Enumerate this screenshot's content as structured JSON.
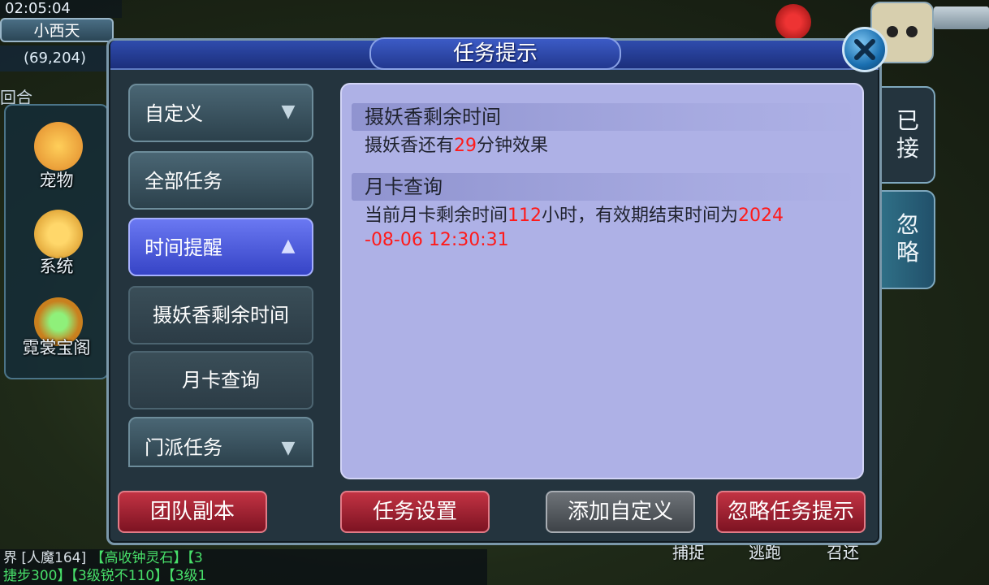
{
  "hud": {
    "time": "02:05:04",
    "map_name": "小西天",
    "coords": "(69,204)",
    "round_label": "回合",
    "side_items": [
      {
        "label": "宠物",
        "icon": "tiger-pet-icon"
      },
      {
        "label": "系统",
        "icon": "gear-system-icon"
      },
      {
        "label": "霓裳宝阁",
        "icon": "treasure-icon"
      }
    ],
    "chat": {
      "line1_prefix": "界",
      "line1_player": "[人魔164]",
      "line1_green": "【高收钟灵石】【3",
      "line2_green": "捷步300】【3级锐不110】【3级1"
    },
    "bottom_labels": [
      "捕捉",
      "逃跑",
      "召还"
    ]
  },
  "dialog": {
    "title": "任务提示",
    "menu": [
      {
        "label": "自定义",
        "chevron": "down",
        "active": false
      },
      {
        "label": "全部任务",
        "chevron": "",
        "active": false
      },
      {
        "label": "时间提醒",
        "chevron": "up",
        "active": true
      }
    ],
    "submenu": [
      "摄妖香剩余时间",
      "月卡查询"
    ],
    "menu_last": {
      "label": "门派任务",
      "chevron": "down"
    },
    "sections": [
      {
        "title": "摄妖香剩余时间",
        "text_before": "摄妖香还有",
        "text_red": "29",
        "text_after": "分钟效果"
      },
      {
        "title": "月卡查询",
        "text_before": "当前月卡剩余时间",
        "text_red": "112",
        "text_mid": "小时，有效期结束时间为",
        "text_red2": "2024",
        "text_red3": "-08-06 12:30:31"
      }
    ],
    "tabs": [
      {
        "label": "已接",
        "active": true
      },
      {
        "label": "忽略",
        "active": false
      }
    ],
    "buttons": {
      "team_dungeon": "团队副本",
      "task_settings": "任务设置",
      "add_custom": "添加自定义",
      "ignore_hints": "忽略任务提示"
    }
  }
}
